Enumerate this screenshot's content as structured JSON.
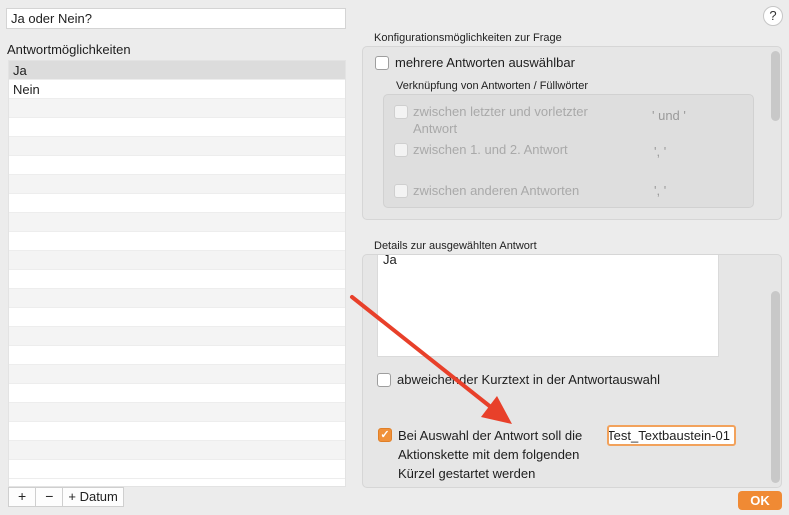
{
  "question": {
    "value": "Ja oder Nein?"
  },
  "help": {
    "label": "?"
  },
  "answers": {
    "label": "Antwortmöglichkeiten",
    "items": [
      "Ja",
      "Nein"
    ]
  },
  "list_buttons": {
    "add": "+",
    "remove": "−",
    "add_date": "+ Datum"
  },
  "config": {
    "title": "Konfigurationsmöglichkeiten zur Frage",
    "multiple_label": "mehrere Antworten auswählbar",
    "linking_title": "Verknüpfung von Antworten / Füllwörter",
    "options": [
      {
        "label": "zwischen letzter und vorletzter Antwort",
        "filler": "' und '"
      },
      {
        "label": "zwischen 1. und 2. Antwort",
        "filler": "', '"
      },
      {
        "label": "zwischen anderen Antworten",
        "filler": "', '"
      }
    ]
  },
  "details": {
    "title": "Details zur ausgewählten Antwort",
    "text": "Ja",
    "shorttext_label": "abweichender Kurztext in der Antwortauswahl",
    "action_label": "Bei Auswahl der Antwort soll die Aktionskette mit dem folgenden Kürzel gestartet werden",
    "shortcut_value": "Test_Textbaustein-01"
  },
  "ok": {
    "label": "OK"
  },
  "colors": {
    "accent": "#f08a34",
    "arrow": "#e8402a"
  }
}
